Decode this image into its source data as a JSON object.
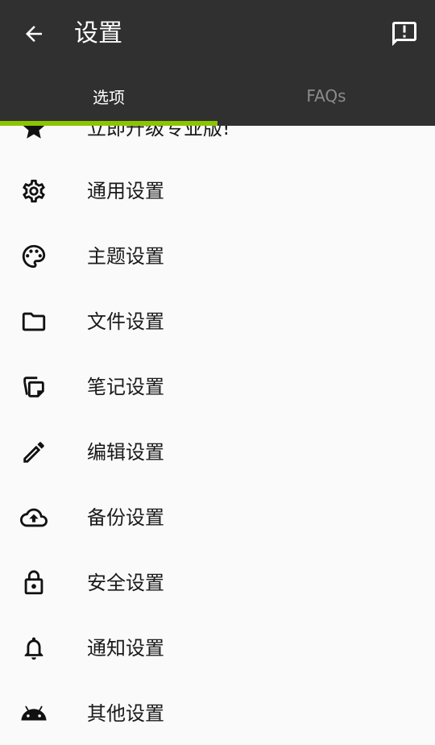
{
  "header": {
    "title": "设置"
  },
  "tabs": [
    {
      "label": "选项"
    },
    {
      "label": "FAQs"
    }
  ],
  "items": [
    {
      "label": "立即升级专业版!",
      "icon": "star-icon"
    },
    {
      "label": "通用设置",
      "icon": "gear-icon"
    },
    {
      "label": "主题设置",
      "icon": "palette-icon"
    },
    {
      "label": "文件设置",
      "icon": "folder-icon"
    },
    {
      "label": "笔记设置",
      "icon": "notes-icon"
    },
    {
      "label": "编辑设置",
      "icon": "pencil-icon"
    },
    {
      "label": "备份设置",
      "icon": "cloud-upload-icon"
    },
    {
      "label": "安全设置",
      "icon": "lock-icon"
    },
    {
      "label": "通知设置",
      "icon": "bell-icon"
    },
    {
      "label": "其他设置",
      "icon": "android-icon"
    }
  ],
  "colors": {
    "toolbar": "#303030",
    "accent": "#8bc400",
    "background": "#fafafa"
  }
}
